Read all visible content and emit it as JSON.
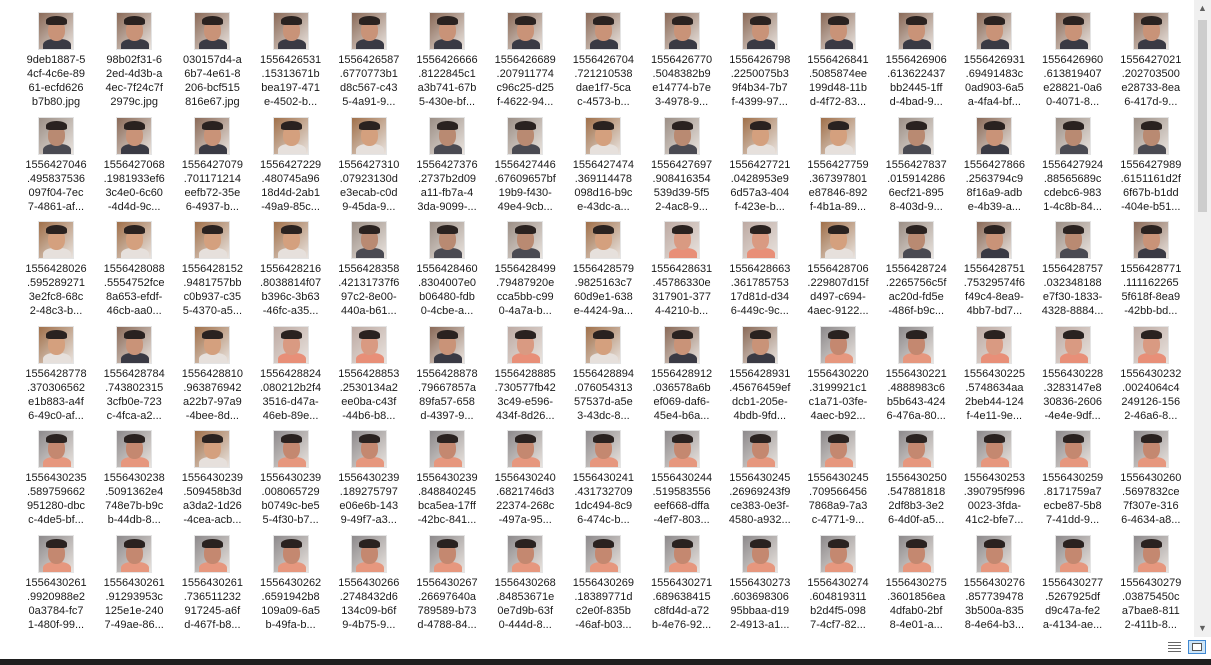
{
  "colors": {
    "background": "#ffffff",
    "text": "#1a1a1a",
    "scrollbar_track": "#f0f0f0",
    "scrollbar_thumb": "#cdcdcd",
    "taskbar": "#1f1f1f"
  },
  "scrollbar": {
    "up_icon": "scroll-up-arrow-icon",
    "down_icon": "scroll-down-arrow-icon",
    "up_glyph": "▲",
    "down_glyph": "▼"
  },
  "statusbar": {
    "details_view_icon": "details-view-icon",
    "thumbnail_view_icon": "large-icons-view-icon"
  },
  "files": [
    {
      "lines": [
        "9deb1887-5",
        "4cf-4c6e-89",
        "61-ecfd626",
        "b7b80.jpg"
      ],
      "thumb": "face-close"
    },
    {
      "lines": [
        "98b02f31-6",
        "2ed-4d3b-a",
        "4ec-7f24c7f",
        "2979c.jpg"
      ],
      "thumb": "face-close"
    },
    {
      "lines": [
        "030157d4-a",
        "6b7-4e61-8",
        "206-bcf515",
        "816e67.jpg"
      ],
      "thumb": "face-close"
    },
    {
      "lines": [
        "1556426531",
        ".15313671b",
        "bea197-471",
        "e-4502-b..."
      ],
      "thumb": "face-close"
    },
    {
      "lines": [
        "1556426587",
        ".6770773b1",
        "d8c567-c43",
        "5-4a91-9..."
      ],
      "thumb": "face-close"
    },
    {
      "lines": [
        "1556426666",
        ".8122845c1",
        "a3b741-67b",
        "5-430e-bf..."
      ],
      "thumb": "face-close"
    },
    {
      "lines": [
        "1556426689",
        ".207911774",
        "c96c25-d25",
        "f-4622-94..."
      ],
      "thumb": "face-close"
    },
    {
      "lines": [
        "1556426704",
        ".721210538",
        "dae1f7-5ca",
        "c-4573-b..."
      ],
      "thumb": "face-close"
    },
    {
      "lines": [
        "1556426770",
        ".5048382b9",
        "e14774-b7e",
        "3-4978-9..."
      ],
      "thumb": "face-close"
    },
    {
      "lines": [
        "1556426798",
        ".2250075b3",
        "9f4b34-7b7",
        "f-4399-97..."
      ],
      "thumb": "face-close"
    },
    {
      "lines": [
        "1556426841",
        ".5085874ee",
        "199d48-11b",
        "d-4f72-83..."
      ],
      "thumb": "face-close"
    },
    {
      "lines": [
        "1556426906",
        ".613622437",
        "bb2445-1ff",
        "d-4bad-9..."
      ],
      "thumb": "face-close"
    },
    {
      "lines": [
        "1556426931",
        ".69491483c",
        "0ad903-6a5",
        "a-4fa4-bf..."
      ],
      "thumb": "face-close"
    },
    {
      "lines": [
        "1556426960",
        ".613819407",
        "e28821-0a6",
        "0-4071-8..."
      ],
      "thumb": "face-close"
    },
    {
      "lines": [
        "1556427021",
        ".202703500",
        "e28733-8ea",
        "6-417d-9..."
      ],
      "thumb": "face-close"
    },
    {
      "lines": [
        "1556427046",
        ".495837536",
        "097f04-7ec",
        "7-4861-af..."
      ],
      "thumb": "indoor"
    },
    {
      "lines": [
        "1556427068",
        ".1981933ef6",
        "3c4e0-6c60",
        "-4d4d-9c..."
      ],
      "thumb": "face-close"
    },
    {
      "lines": [
        "1556427079",
        ".701171214",
        "eefb72-35e",
        "6-4937-b..."
      ],
      "thumb": "face-close"
    },
    {
      "lines": [
        "1556427229",
        ".480745a96",
        "18d4d-2ab1",
        "-49a9-85c..."
      ],
      "thumb": "door"
    },
    {
      "lines": [
        "1556427310",
        ".07923130d",
        "e3ecab-c0d",
        "9-45da-9..."
      ],
      "thumb": "door"
    },
    {
      "lines": [
        "1556427376",
        ".2737b2d09",
        "a11-fb7a-4",
        "3da-9099-..."
      ],
      "thumb": "indoor"
    },
    {
      "lines": [
        "1556427446",
        ".67609657bf",
        "19b9-f430-",
        "49e4-9cb..."
      ],
      "thumb": "indoor"
    },
    {
      "lines": [
        "1556427474",
        ".369114478",
        "098d16-b9c",
        "e-43dc-a..."
      ],
      "thumb": "door"
    },
    {
      "lines": [
        "1556427697",
        ".908416354",
        "539d39-5f5",
        "2-4ac8-9..."
      ],
      "thumb": "indoor"
    },
    {
      "lines": [
        "1556427721",
        ".0428953e9",
        "6d57a3-404",
        "f-423e-b..."
      ],
      "thumb": "door"
    },
    {
      "lines": [
        "1556427759",
        ".367397801",
        "e87846-892",
        "f-4b1a-89..."
      ],
      "thumb": "door"
    },
    {
      "lines": [
        "1556427837",
        ".015914286",
        "6ecf21-895",
        "8-403d-9..."
      ],
      "thumb": "indoor"
    },
    {
      "lines": [
        "1556427866",
        ".2563794c9",
        "8f16a9-adb",
        "e-4b39-a..."
      ],
      "thumb": "face-close"
    },
    {
      "lines": [
        "1556427924",
        ".88565689c",
        "cdebc6-983",
        "1-4c8b-84..."
      ],
      "thumb": "indoor"
    },
    {
      "lines": [
        "1556427989",
        ".6151161d2f",
        "6f67b-b1dd",
        "-404e-b51..."
      ],
      "thumb": "indoor"
    },
    {
      "lines": [
        "1556428026",
        ".595289271",
        "3e2fc8-68c",
        "2-48c3-b..."
      ],
      "thumb": "door"
    },
    {
      "lines": [
        "1556428088",
        ".5554752fce",
        "8a653-efdf-",
        "46cb-aa0..."
      ],
      "thumb": "door"
    },
    {
      "lines": [
        "1556428152",
        ".9481757bb",
        "c0b937-c35",
        "5-4370-a5..."
      ],
      "thumb": "door"
    },
    {
      "lines": [
        "1556428216",
        ".8038814f07",
        "b396c-3b63",
        "-46fc-a35..."
      ],
      "thumb": "door"
    },
    {
      "lines": [
        "1556428358",
        ".42131737f6",
        "97c2-8e00-",
        "440a-b61..."
      ],
      "thumb": "indoor"
    },
    {
      "lines": [
        "1556428460",
        ".8304007e0",
        "b06480-fdb",
        "0-4cbe-a..."
      ],
      "thumb": "indoor"
    },
    {
      "lines": [
        "1556428499",
        ".79487920e",
        "cca5bb-c99",
        "0-4a7a-b..."
      ],
      "thumb": "indoor"
    },
    {
      "lines": [
        "1556428579",
        ".9825163c7",
        "60d9e1-638",
        "e-4424-9a..."
      ],
      "thumb": "door"
    },
    {
      "lines": [
        "1556428631",
        ".45786330e",
        "317901-377",
        "4-4210-b..."
      ],
      "thumb": "pink"
    },
    {
      "lines": [
        "1556428663",
        ".361785753",
        "17d81d-d34",
        "6-449c-9c..."
      ],
      "thumb": "pink"
    },
    {
      "lines": [
        "1556428706",
        ".229807d15f",
        "d497-c694-",
        "4aec-9122..."
      ],
      "thumb": "door"
    },
    {
      "lines": [
        "1556428724",
        ".2265756c5f",
        "ac20d-fd5e",
        "-486f-b9c..."
      ],
      "thumb": "indoor"
    },
    {
      "lines": [
        "1556428751",
        ".75329574f6",
        "f49c4-8ea9-",
        "4bb7-bd7..."
      ],
      "thumb": "face-close"
    },
    {
      "lines": [
        "1556428757",
        ".032348188",
        "e7f30-1833-",
        "4328-8884..."
      ],
      "thumb": "indoor"
    },
    {
      "lines": [
        "1556428771",
        ".111162265",
        "5f618f-8ea9",
        "-42bb-bd..."
      ],
      "thumb": "face-close"
    },
    {
      "lines": [
        "1556428778",
        ".370306562",
        "e1b883-a4f",
        "6-49c0-af..."
      ],
      "thumb": "door"
    },
    {
      "lines": [
        "1556428784",
        ".743802315",
        "3cfb0e-723",
        "c-4fca-a2..."
      ],
      "thumb": "face-close"
    },
    {
      "lines": [
        "1556428810",
        ".963876942",
        "a22b7-97a9",
        "-4bee-8d..."
      ],
      "thumb": "door"
    },
    {
      "lines": [
        "1556428824",
        ".080212b2f4",
        "3516-d47a-",
        "46eb-89e..."
      ],
      "thumb": "pink"
    },
    {
      "lines": [
        "1556428853",
        ".2530134a2",
        "ee0ba-c43f",
        "-44b6-b8..."
      ],
      "thumb": "pink"
    },
    {
      "lines": [
        "1556428878",
        ".79667857a",
        "89fa57-658",
        "d-4397-9..."
      ],
      "thumb": "face-close"
    },
    {
      "lines": [
        "1556428885",
        ".730577fb42",
        "3c49-e596-",
        "434f-8d26..."
      ],
      "thumb": "pink"
    },
    {
      "lines": [
        "1556428894",
        ".076054313",
        "57537d-a5e",
        "3-43dc-8..."
      ],
      "thumb": "door"
    },
    {
      "lines": [
        "1556428912",
        ".036578a6b",
        "ef069-daf6-",
        "45e4-b6a..."
      ],
      "thumb": "face-close"
    },
    {
      "lines": [
        "1556428931",
        ".45676459ef",
        "dcb1-205e-",
        "4bdb-9fd..."
      ],
      "thumb": "face-close"
    },
    {
      "lines": [
        "1556430220",
        ".3199921c1",
        "c1a71-03fe-",
        "4aec-b92..."
      ],
      "thumb": "office"
    },
    {
      "lines": [
        "1556430221",
        ".4888983c6",
        "b5b643-424",
        "6-476a-80..."
      ],
      "thumb": "office"
    },
    {
      "lines": [
        "1556430225",
        ".5748634aa",
        "2beb44-124",
        "f-4e11-9e..."
      ],
      "thumb": "pink"
    },
    {
      "lines": [
        "1556430228",
        ".3283147e8",
        "30836-2606",
        "-4e4e-9df..."
      ],
      "thumb": "pink"
    },
    {
      "lines": [
        "1556430232",
        ".0024064c4",
        "249126-156",
        "2-46a6-8..."
      ],
      "thumb": "pink"
    },
    {
      "lines": [
        "1556430235",
        ".589759662",
        "951280-dbc",
        "c-4de5-bf..."
      ],
      "thumb": "office"
    },
    {
      "lines": [
        "1556430238",
        ".5091362e4",
        "748e7b-b9c",
        "b-44db-8..."
      ],
      "thumb": "office"
    },
    {
      "lines": [
        "1556430239",
        ".509458b3d",
        "a3da2-1d26",
        "-4cea-acb..."
      ],
      "thumb": "door"
    },
    {
      "lines": [
        "1556430239",
        ".008065729",
        "b0749c-be5",
        "5-4f30-b7..."
      ],
      "thumb": "office"
    },
    {
      "lines": [
        "1556430239",
        ".189275797",
        "e06e6b-143",
        "9-49f7-a3..."
      ],
      "thumb": "office"
    },
    {
      "lines": [
        "1556430239",
        ".848840245",
        "bca5ea-17ff",
        "-42bc-841..."
      ],
      "thumb": "office"
    },
    {
      "lines": [
        "1556430240",
        ".6821746d3",
        "22374-268c",
        "-497a-95..."
      ],
      "thumb": "office"
    },
    {
      "lines": [
        "1556430241",
        ".431732709",
        "1dc494-8c9",
        "6-474c-b..."
      ],
      "thumb": "office"
    },
    {
      "lines": [
        "1556430244",
        ".519583556",
        "eef668-dffa",
        "-4ef7-803..."
      ],
      "thumb": "office"
    },
    {
      "lines": [
        "1556430245",
        ".26969243f9",
        "ce383-0e3f-",
        "4580-a932..."
      ],
      "thumb": "office"
    },
    {
      "lines": [
        "1556430245",
        ".709566456",
        "7868a9-7a3",
        "c-4771-9..."
      ],
      "thumb": "office"
    },
    {
      "lines": [
        "1556430250",
        ".547881818",
        "2df8b3-3e2",
        "6-4d0f-a5..."
      ],
      "thumb": "office"
    },
    {
      "lines": [
        "1556430253",
        ".390795f996",
        "0023-3fda-",
        "41c2-bfe7..."
      ],
      "thumb": "office"
    },
    {
      "lines": [
        "1556430259",
        ".8171759a7",
        "ecbe87-5b8",
        "7-41dd-9..."
      ],
      "thumb": "office"
    },
    {
      "lines": [
        "1556430260",
        ".5697832ce",
        "7f307e-316",
        "6-4634-a8..."
      ],
      "thumb": "office"
    },
    {
      "lines": [
        "1556430261",
        ".9920988e2",
        "0a3784-fc7",
        "1-480f-99..."
      ],
      "thumb": "office"
    },
    {
      "lines": [
        "1556430261",
        ".91293953c",
        "125e1e-240",
        "7-49ae-86..."
      ],
      "thumb": "office"
    },
    {
      "lines": [
        "1556430261",
        ".736511232",
        "917245-a6f",
        "d-467f-b8..."
      ],
      "thumb": "office"
    },
    {
      "lines": [
        "1556430262",
        ".6591942b8",
        "109a09-6a5",
        "b-49fa-b..."
      ],
      "thumb": "office"
    },
    {
      "lines": [
        "1556430266",
        ".2748432d6",
        "134c09-b6f",
        "9-4b75-9..."
      ],
      "thumb": "office"
    },
    {
      "lines": [
        "1556430267",
        ".26697640a",
        "789589-b73",
        "d-4788-84..."
      ],
      "thumb": "office"
    },
    {
      "lines": [
        "1556430268",
        ".84853671e",
        "0e7d9b-63f",
        "0-444d-8..."
      ],
      "thumb": "office"
    },
    {
      "lines": [
        "1556430269",
        ".18389771d",
        "c2e0f-835b",
        "-46af-b03..."
      ],
      "thumb": "office"
    },
    {
      "lines": [
        "1556430271",
        ".689638415",
        "c8fd4d-a72",
        "b-4e76-92..."
      ],
      "thumb": "office"
    },
    {
      "lines": [
        "1556430273",
        ".603698306",
        "95bbaa-d19",
        "2-4913-a1..."
      ],
      "thumb": "office"
    },
    {
      "lines": [
        "1556430274",
        ".604819311",
        "b2d4f5-098",
        "7-4cf7-82..."
      ],
      "thumb": "office"
    },
    {
      "lines": [
        "1556430275",
        ".3601856ea",
        "4dfab0-2bf",
        "8-4e01-a..."
      ],
      "thumb": "office"
    },
    {
      "lines": [
        "1556430276",
        ".857739478",
        "3b500a-835",
        "8-4e64-b3..."
      ],
      "thumb": "office"
    },
    {
      "lines": [
        "1556430277",
        ".5267925df",
        "d9c47a-fe2",
        "a-4134-ae..."
      ],
      "thumb": "office"
    },
    {
      "lines": [
        "1556430279",
        ".03875450c",
        "a7bae8-811",
        "2-411b-8..."
      ],
      "thumb": "office"
    }
  ]
}
